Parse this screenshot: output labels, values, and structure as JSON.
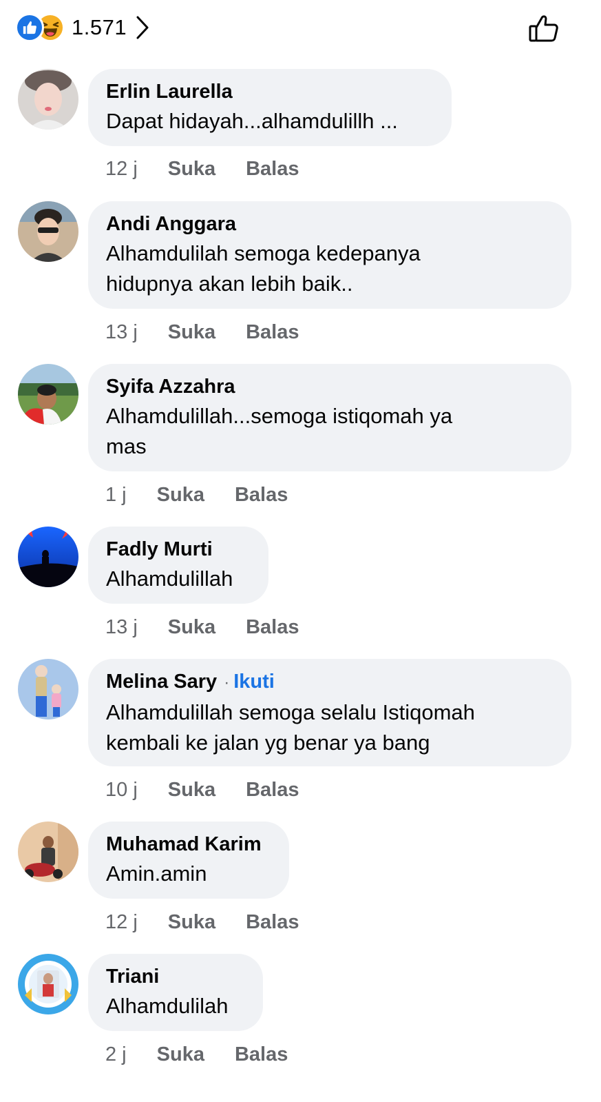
{
  "header": {
    "reaction_count": "1.571",
    "reaction_icons": [
      "like-icon",
      "haha-icon"
    ],
    "chevron_icon": "chevron-right-icon",
    "like_button_icon": "thumbs-up-outline-icon"
  },
  "colors": {
    "bubble": "#f0f2f5",
    "link_blue": "#1b74e4",
    "meta_gray": "#65676b",
    "haha_yellow": "#f7b125"
  },
  "comments": [
    {
      "author": "Erlin Laurella",
      "text": "Dapat hidayah...alhamdulillh ...",
      "time": "12 j",
      "like": "Suka",
      "reply": "Balas"
    },
    {
      "author": "Andi Anggara",
      "text": "Alhamdulilah semoga kedepanya\nhidupnya akan lebih baik..",
      "time": "13 j",
      "like": "Suka",
      "reply": "Balas"
    },
    {
      "author": "Syifa Azzahra",
      "text": "Alhamdulillah...semoga istiqomah ya\nmas",
      "time": "1 j",
      "like": "Suka",
      "reply": "Balas"
    },
    {
      "author": "Fadly Murti",
      "text": "Alhamdulillah",
      "time": "13 j",
      "like": "Suka",
      "reply": "Balas"
    },
    {
      "author": "Melina Sary",
      "follow": "Ikuti",
      "text": "Alhamdulillah semoga selalu Istiqomah\nkembali ke jalan yg benar ya bang",
      "time": "10 j",
      "like": "Suka",
      "reply": "Balas"
    },
    {
      "author": "Muhamad Karim",
      "text": "Amin.amin",
      "time": "12 j",
      "like": "Suka",
      "reply": "Balas"
    },
    {
      "author": "Triani",
      "text": "Alhamdulilah",
      "time": "2 j",
      "like": "Suka",
      "reply": "Balas"
    }
  ]
}
